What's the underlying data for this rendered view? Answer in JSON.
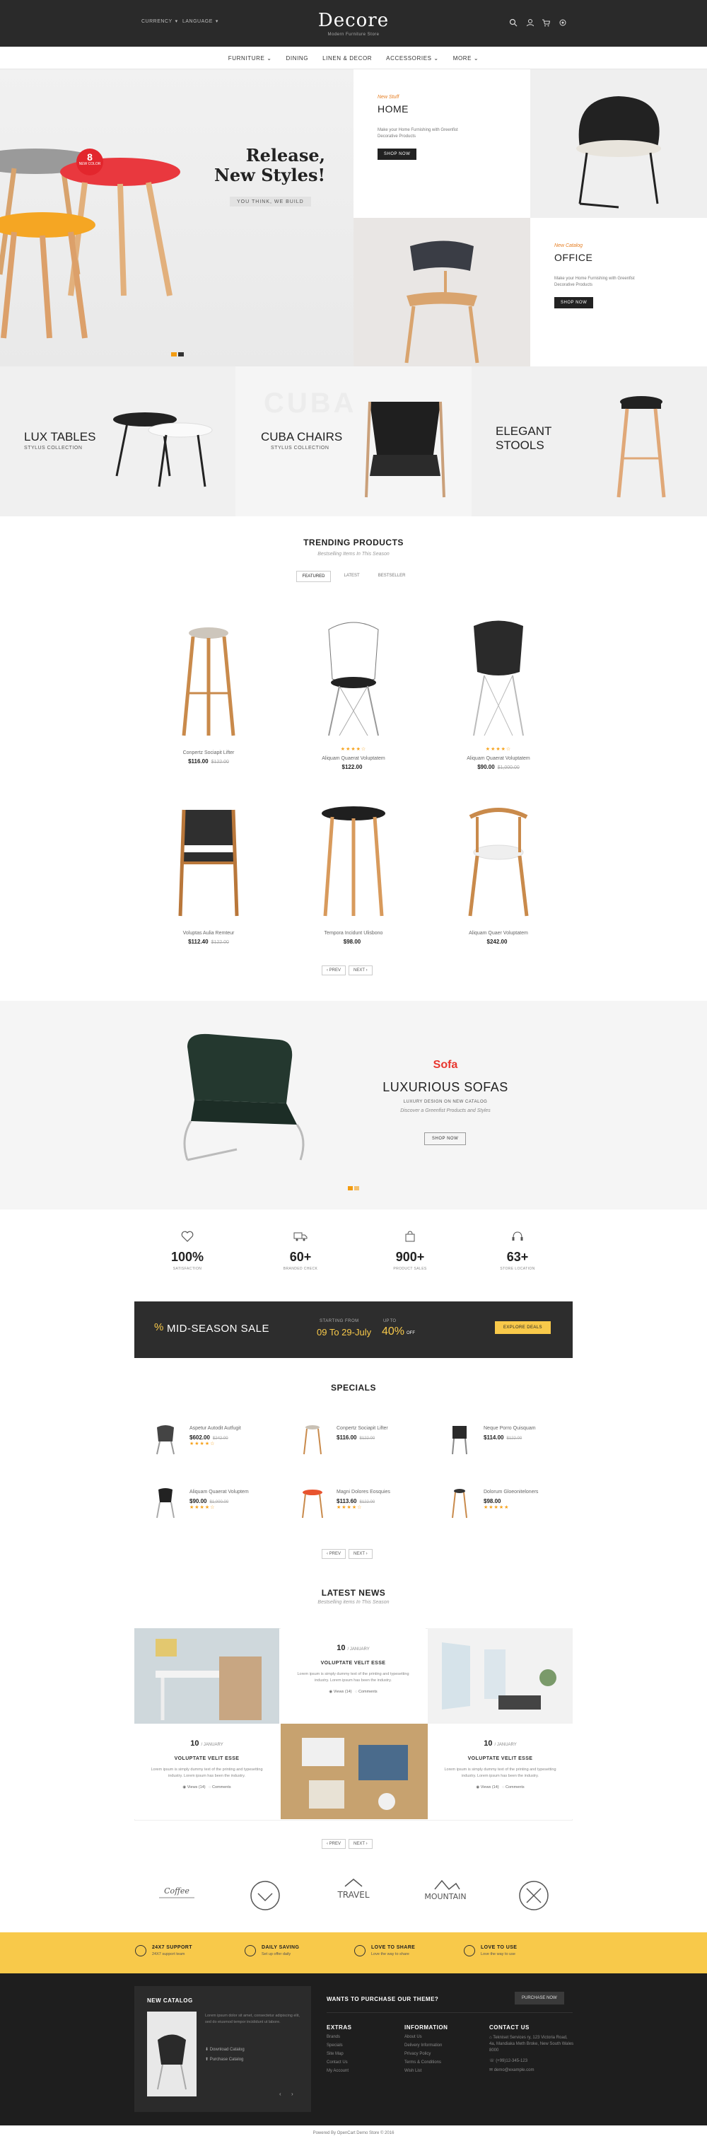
{
  "header": {
    "currency": "CURRENCY",
    "language": "LANGUAGE",
    "logo": "Decore",
    "tagline": "Modern Furniture Store",
    "icons": [
      "search-icon",
      "user-icon",
      "cart-icon",
      "settings-icon"
    ]
  },
  "nav": {
    "items": [
      "FURNITURE ⌄",
      "DINING",
      "LINEN & DECOR",
      "ACCESSORIES ⌄",
      "MORE ⌄"
    ]
  },
  "hero": {
    "title_line1": "Release,",
    "title_line2": "New Styles!",
    "subtitle": "YOU THINK, WE BUILD",
    "badge_line1": "8",
    "badge_line2": "NEW COLOR"
  },
  "promos": {
    "home": {
      "kicker": "New Stuff",
      "title": "HOME",
      "desc": "Make your Home Furnishing with Greenfist Decorative Products",
      "button": "SHOP NOW"
    },
    "office": {
      "kicker": "New Catalog",
      "title": "OFFICE",
      "desc": "Make your Home Furnishing with Greenfist Decorative Products",
      "button": "SHOP NOW"
    }
  },
  "banners": [
    {
      "title": "LUX TABLES",
      "sub": "STYLUS COLLECTION"
    },
    {
      "title": "CUBA CHAIRS",
      "sub": "STYLUS COLLECTION",
      "bg": "CUBA"
    },
    {
      "title": "ELEGANT",
      "title2": "STOOLS",
      "sub": ""
    }
  ],
  "trending": {
    "title": "TRENDING PRODUCTS",
    "subtitle": "Bestselling Items In This Season",
    "tabs": [
      "FEATURED",
      "LATEST",
      "BESTSELLER"
    ],
    "products": [
      {
        "name": "Conpertz Sociapit Lifter",
        "price": "$116.00",
        "old": "$122.00",
        "stars": ""
      },
      {
        "name": "Aliquam Quaerat Voluptatem",
        "price": "$122.00",
        "old": "",
        "stars": "★★★★☆"
      },
      {
        "name": "Aliquam Quaerat Voluptatem",
        "price": "$90.00",
        "old": "$1,000.00",
        "stars": "★★★★☆"
      },
      {
        "name": "Voluptas Aulia Remteur",
        "price": "$112.40",
        "old": "$122.00",
        "stars": ""
      },
      {
        "name": "Tempora Incidunt Ulisbono",
        "price": "$98.00",
        "old": "",
        "stars": ""
      },
      {
        "name": "Aliquam Quaer Voluptatem",
        "price": "$242.00",
        "old": "",
        "stars": ""
      }
    ],
    "prev": "‹ PREV",
    "next": "NEXT ›"
  },
  "sofa": {
    "kicker": "Sofa",
    "title": "LUXURIOUS SOFAS",
    "sub": "LUXURY DESIGN ON NEW CATALOG",
    "desc": "Discover a Greenfist Products and Styles",
    "button": "SHOP NOW"
  },
  "stats": [
    {
      "num": "100%",
      "label": "SATISFACTION",
      "icon": "heart-icon"
    },
    {
      "num": "60+",
      "label": "BRANDED CHECK",
      "icon": "truck-icon"
    },
    {
      "num": "900+",
      "label": "PRODUCT SALES",
      "icon": "bag-icon"
    },
    {
      "num": "63+",
      "label": "STORE LOCATION",
      "icon": "headset-icon"
    }
  ],
  "sale": {
    "title": "MID-SEASON SALE",
    "starting": "STARTING FROM",
    "dates": "09 To 29-July",
    "upto": "UP TO",
    "percent": "40%",
    "off": "OFF",
    "button": "EXPLORE DEALS"
  },
  "specials": {
    "title": "SPECIALS",
    "items": [
      {
        "name": "Aspetur Autodit Autfugit",
        "price": "$602.00",
        "old": "$242.00"
      },
      {
        "name": "Conpertz Sociapit Lifter",
        "price": "$116.00",
        "old": "$122.00"
      },
      {
        "name": "Neque Porro Quisquam",
        "price": "$114.00",
        "old": "$122.00"
      },
      {
        "name": "Aliquam Quaerat Voluptem",
        "price": "$90.00",
        "old": "$1,000.00"
      },
      {
        "name": "Magni Dolores Eosquies",
        "price": "$113.60",
        "old": "$122.00"
      },
      {
        "name": "Dolorum Gloeoniteloners",
        "price": "$98.00",
        "old": ""
      }
    ],
    "prev": "‹ PREV",
    "next": "NEXT ›"
  },
  "news": {
    "title": "LATEST NEWS",
    "subtitle": "Bestselling items In This Season",
    "posts": [
      {
        "day": "10",
        "month": "/ JANUARY",
        "title": "VOLUPTATE VELIT ESSE",
        "desc": "Lorem ipsum is simply dummy text of the printing and typesetting industry. Lorem ipsum has been the industry.",
        "views": "Views (14)",
        "comments": "Comments"
      },
      {
        "day": "10",
        "month": "/ JANUARY",
        "title": "VOLUPTATE VELIT ESSE",
        "desc": "Lorem ipsum is simply dummy text of the printing and typesetting industry. Lorem ipsum has been the industry.",
        "views": "Views (14)",
        "comments": "Comments"
      },
      {
        "day": "10",
        "month": "/ JANUARY",
        "title": "VOLUPTATE VELIT ESSE",
        "desc": "Lorem ipsum is simply dummy text of the printing and typesetting industry. Lorem ipsum has been the industry.",
        "views": "Views (14)",
        "comments": "Comments"
      }
    ],
    "prev": "‹ PREV",
    "next": "NEXT ›"
  },
  "brands": [
    "Coffee",
    "Brand",
    "TRAVEL",
    "MOUNTAIN",
    "Brand"
  ],
  "features": [
    {
      "title": "24X7 SUPPORT",
      "sub": "24X7 support team"
    },
    {
      "title": "DAILY SAVING",
      "sub": "Set up offer daily"
    },
    {
      "title": "LOVE TO SHARE",
      "sub": "Love the way to share"
    },
    {
      "title": "LOVE TO USE",
      "sub": "Love the way to use"
    }
  ],
  "footer": {
    "catalog_title": "NEW CATALOG",
    "catalog_desc": "Lorem ipsum dolor sit amet, consectetur adipiscing elit, sed do eiusmod tempor incididunt ut labore.",
    "catalog_links": [
      "Download Catalog",
      "Purchase Catalog"
    ],
    "purchase_q": "WANTS TO PURCHASE OUR THEME?",
    "purchase_btn": "PURCHASE NOW",
    "extras_title": "EXTRAS",
    "extras": [
      "Brands",
      "Specials",
      "Site Map",
      "Contact Us",
      "My Account"
    ],
    "info_title": "INFORMATION",
    "info": [
      "About Us",
      "Delivery Information",
      "Privacy Policy",
      "Terms & Conditions",
      "Wish List"
    ],
    "contact_title": "CONTACT US",
    "contact": [
      "Tekniset Services ry, 123 Victoria Road, 4a, Mandiaka Meth Broke, New South Wales 8000",
      "(+99)12-345-123",
      "demo@example.com"
    ]
  },
  "bottom": "Powered By OpenCart Demo Store © 2016"
}
